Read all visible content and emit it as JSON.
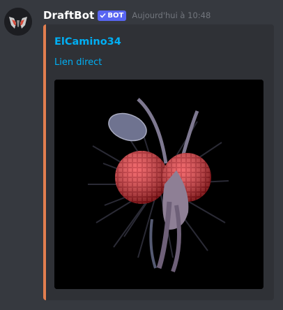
{
  "message": {
    "username": "DraftBot",
    "bot_tag": "BOT",
    "timestamp": "Aujourd'hui à 10:48"
  },
  "embed": {
    "title": "ElCamino34",
    "link_text": "Lien direct",
    "accent_color": "#e27e4f",
    "image": "fly-artwork"
  },
  "colors": {
    "background": "#36393f",
    "embed_background": "#2f3136",
    "link": "#00aff4",
    "bot_tag": "#5865f2"
  }
}
